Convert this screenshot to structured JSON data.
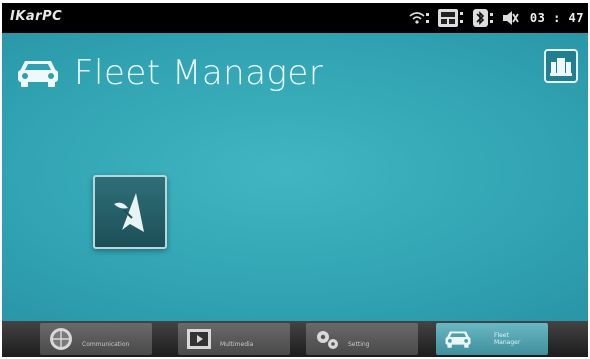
{
  "status_bar": {
    "brand": "IKarPC",
    "time": "03 : 47",
    "icons": [
      "wifi-icon",
      "signal-icon",
      "bluetooth-icon",
      "mute-icon"
    ]
  },
  "app": {
    "title": "Fleet Manager",
    "title_icon": "car-icon",
    "top_right_button_icon": "buildings-icon"
  },
  "tiles": [
    {
      "name": "navigation-tile",
      "icon": "compass-arrow-icon"
    }
  ],
  "dock": {
    "items": [
      {
        "label": "Communication",
        "icon": "globe-icon",
        "active": false
      },
      {
        "label": "Multimedia",
        "icon": "video-icon",
        "active": false
      },
      {
        "label": "Setting",
        "icon": "gears-icon",
        "active": false
      },
      {
        "label": "Fleet Manager",
        "icon": "car-icon",
        "active": true
      }
    ]
  },
  "colors": {
    "screen": "#2fa0b0",
    "accent_active": "#5aaab6",
    "title_text": "#eef9fb"
  }
}
